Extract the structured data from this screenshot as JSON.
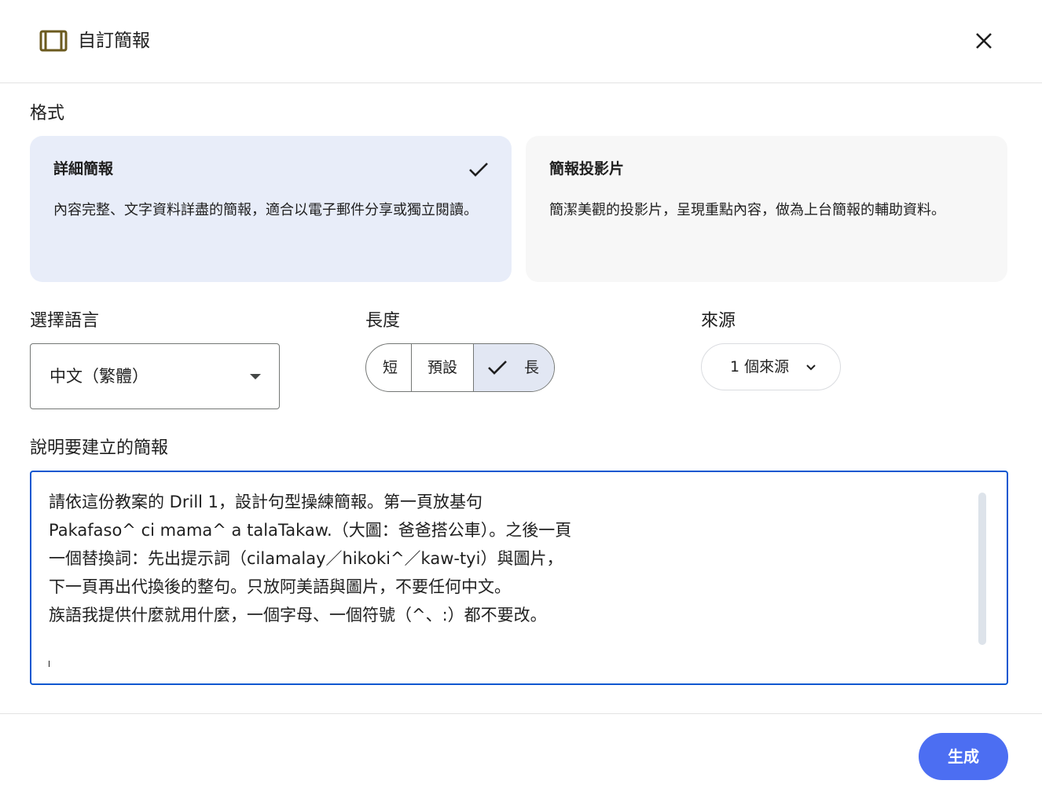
{
  "header": {
    "title": "自訂簡報",
    "icon": "slides-frame-icon",
    "close_icon": "close-icon"
  },
  "format": {
    "label": "格式",
    "options": [
      {
        "title": "詳細簡報",
        "description": "內容完整、文字資料詳盡的簡報，適合以電子郵件分享或獨立閱讀。",
        "selected": true
      },
      {
        "title": "簡報投影片",
        "description": "簡潔美觀的投影片，呈現重點內容，做為上台簡報的輔助資料。",
        "selected": false
      }
    ]
  },
  "language": {
    "label": "選擇語言",
    "value": "中文（繁體）"
  },
  "length": {
    "label": "長度",
    "options": [
      "短",
      "預設",
      "長"
    ],
    "selected": "長"
  },
  "source": {
    "label": "來源",
    "value": "1 個來源"
  },
  "description": {
    "label": "說明要建立的簡報",
    "value": "請依這份教案的 Drill 1，設計句型操練簡報。第一頁放基句\nPakafaso^ ci mama^ a talaTakaw.（大圖：爸爸搭公車）。之後一頁\n一個替換詞：先出提示詞（cilamalay／hikoki^／kaw-tyi）與圖片，\n下一頁再出代換後的整句。只放阿美語與圖片，不要任何中文。\n族語我提供什麼就用什麼，一個字母、一個符號（^、:）都不要改。"
  },
  "footer": {
    "generate_label": "生成"
  },
  "colors": {
    "accent": "#0b57d0",
    "button": "#4c6ef2",
    "selected_card": "#e8edf9"
  }
}
